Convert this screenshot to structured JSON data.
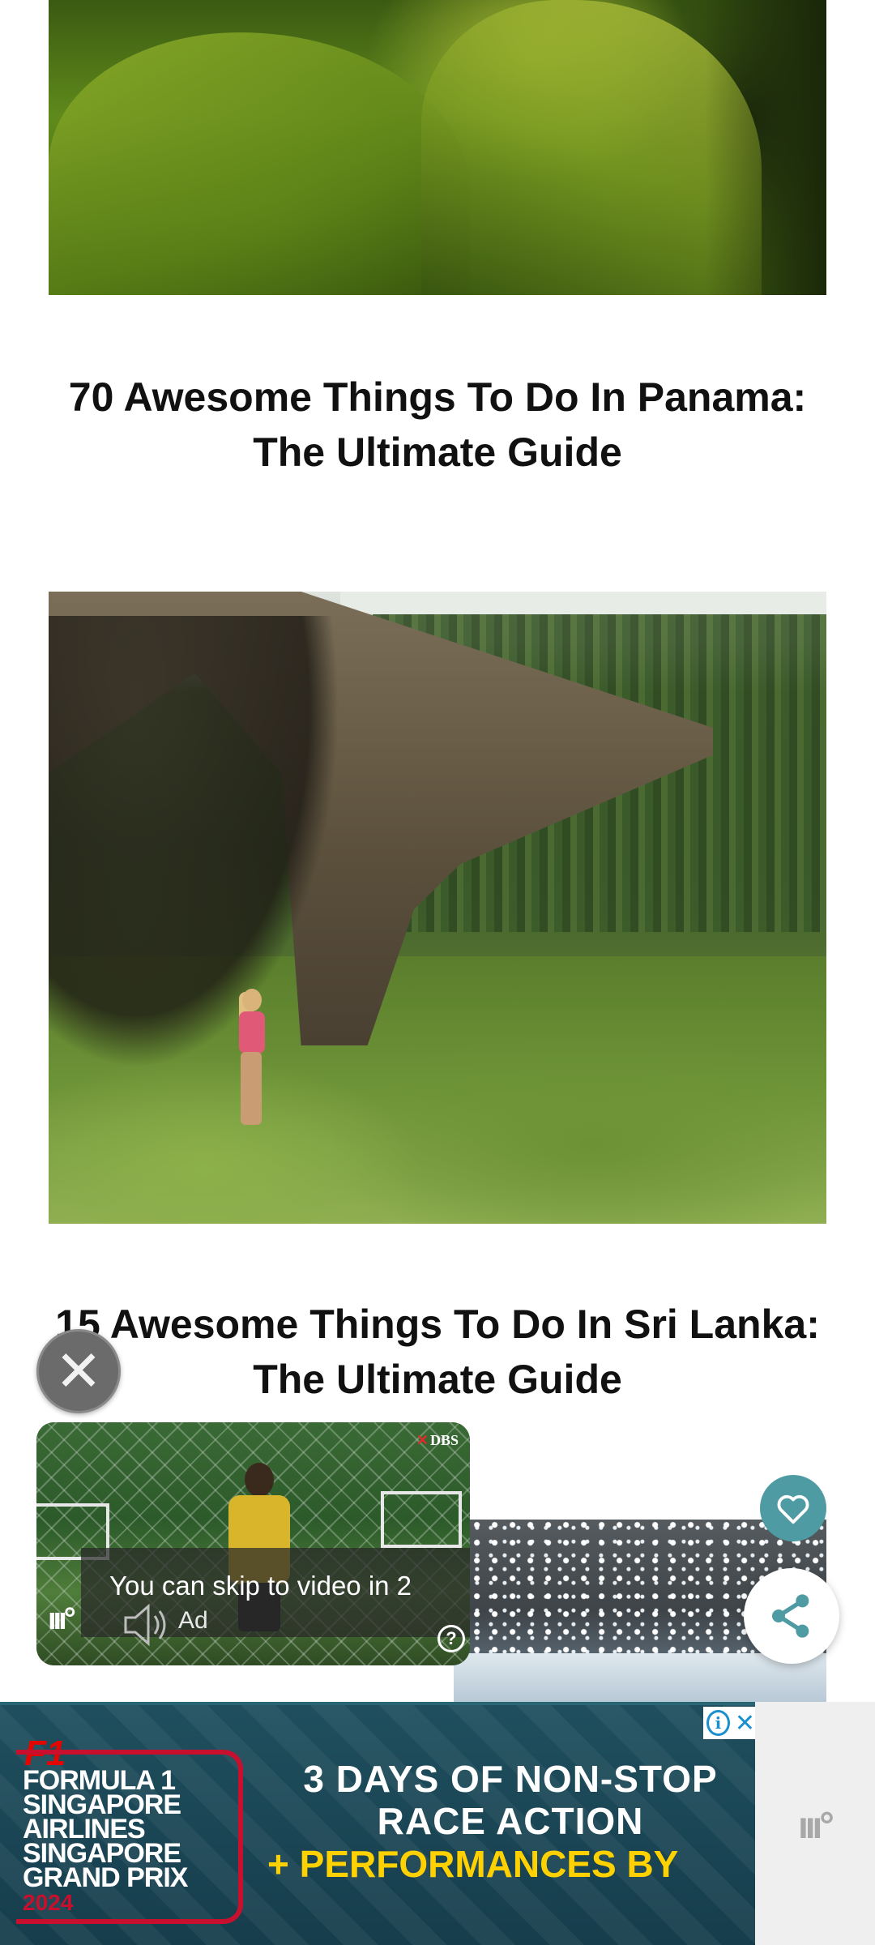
{
  "posts": [
    {
      "title": "70 Awesome Things To Do In Panama: The Ultimate Guide"
    },
    {
      "title": "15 Awesome Things To Do In Sri Lanka: The Ultimate Guide"
    }
  ],
  "video_ad": {
    "brand": "DBS",
    "skip_text": "You can skip to video in 2",
    "ad_label": "Ad",
    "help_glyph": "?",
    "close_glyph": "✕",
    "player_logo": "ııı°"
  },
  "floating_actions": {
    "heart_color": "#4f9ba3"
  },
  "banner_ad": {
    "logo_mark": "F1",
    "event_lines": [
      "FORMULA 1",
      "SINGAPORE",
      "AIRLINES",
      "SINGAPORE",
      "GRAND PRIX"
    ],
    "event_year": "2024",
    "headline": "3 DAYS OF NON-STOP RACE ACTION",
    "headline_accent": "+ PERFORMANCES BY",
    "adchoices_glyph": "i",
    "close_glyph": "✕",
    "side_logo": "ııı°"
  }
}
